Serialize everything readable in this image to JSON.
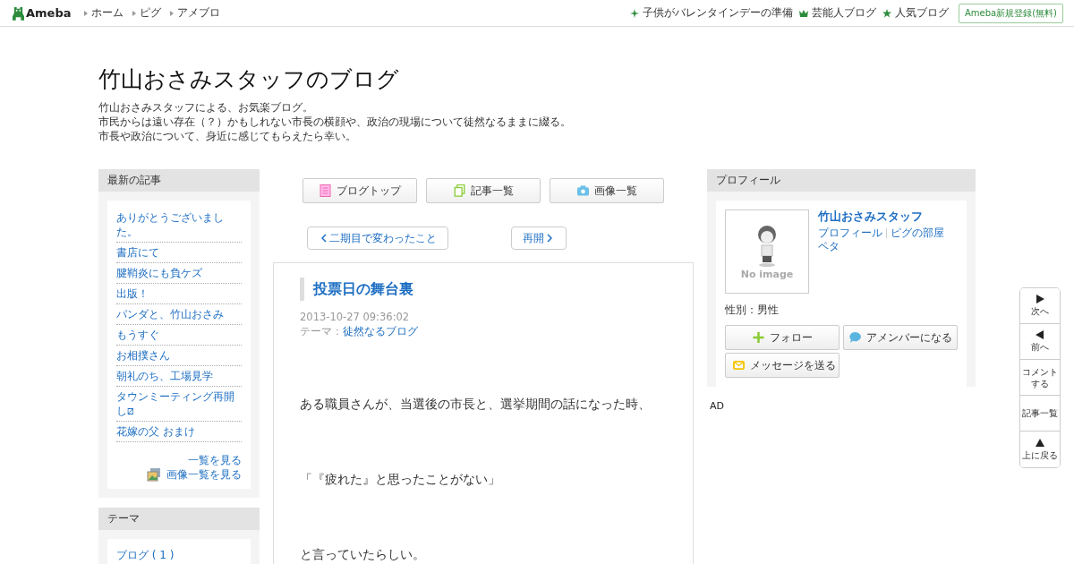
{
  "header": {
    "logo": "Ameba",
    "nav": [
      "ホーム",
      "ピグ",
      "アメブロ"
    ],
    "links": [
      {
        "kind": "sparkle",
        "label": "子供がバレンタインデーの準備"
      },
      {
        "kind": "crown",
        "label": "芸能人ブログ"
      },
      {
        "kind": "star",
        "label": "人気ブログ"
      }
    ],
    "register": "Ameba新規登録(無料)"
  },
  "blog": {
    "title": "竹山おさみスタッフのブログ",
    "description": [
      "竹山おさみスタッフによる、お気楽ブログ。",
      "市民からは遠い存在（？）かもしれない市長の横顔や、政治の現場について徒然なるままに綴る。",
      "市長や政治について、身近に感じてもらえたら幸い。"
    ]
  },
  "recent": {
    "heading": "最新の記事",
    "items": [
      "ありがとうございました。",
      "書店にて",
      "腱鞘炎にも負ケズ",
      "出版！",
      "パンダと、竹山おさみ",
      "もうすぐ",
      "お相撲さん",
      "朝礼のち、工場見学",
      "タウンミーティング再開し⧄",
      "花嫁の父 おまけ"
    ],
    "more": "一覧を見る",
    "images": "画像一覧を見る"
  },
  "themes": {
    "heading": "テーマ",
    "items": [
      "ブログ ( 1 )"
    ]
  },
  "tabs": [
    {
      "kind": "top",
      "label": "ブログトップ"
    },
    {
      "kind": "list",
      "label": "記事一覧"
    },
    {
      "kind": "image",
      "label": "画像一覧"
    }
  ],
  "pager": {
    "prev": "二期目で変わったこと",
    "next": "再開"
  },
  "article": {
    "title": "投票日の舞台裏",
    "date": "2013-10-27 09:36:02",
    "theme_label": "テーマ：",
    "theme": "徒然なるブログ",
    "paragraphs": [
      "ある職員さんが、当選後の市長と、選挙期間の話になった時、",
      "「『疲れた』と思ったことがない」",
      "と言っていたらしい。"
    ]
  },
  "profile": {
    "heading": "プロフィール",
    "avatar_caption": "No image",
    "name": "竹山おさみスタッフ",
    "links": [
      "プロフィール",
      "ピグの部屋"
    ],
    "peta": "ペタ",
    "gender": "性別：男性",
    "buttons": [
      {
        "kind": "follow",
        "label": "フォロー"
      },
      {
        "kind": "amember",
        "label": "アメンバーになる"
      },
      {
        "kind": "message",
        "label": "メッセージを送る"
      }
    ]
  },
  "ad": "AD",
  "side_nav": [
    {
      "kind": "next",
      "label": "次へ"
    },
    {
      "kind": "prev",
      "label": "前へ"
    },
    {
      "kind": "text",
      "label": "コメントする"
    },
    {
      "kind": "text",
      "label": "記事一覧"
    },
    {
      "kind": "top",
      "label": "上に戻る"
    }
  ]
}
